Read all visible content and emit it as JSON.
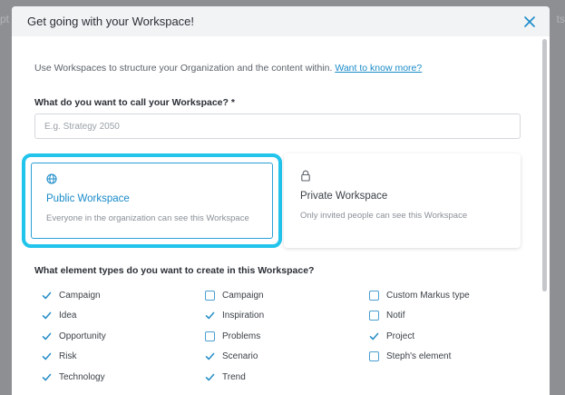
{
  "background": {
    "left_fragment": "pt",
    "right_fragment": "ts"
  },
  "modal": {
    "title": "Get going with your Workspace!",
    "intro_text": "Use Workspaces to structure your Organization and the content within.",
    "intro_link": "Want to know more?",
    "name_label": "What do you want to call your Workspace? *",
    "name_placeholder": "E.g. Strategy 2050",
    "public_card": {
      "title": "Public Workspace",
      "description": "Everyone in the organization can see this Workspace",
      "icon": "globe-icon"
    },
    "private_card": {
      "title": "Private Workspace",
      "description": "Only invited people can see this Workspace",
      "icon": "lock-icon"
    },
    "types_label": "What element types do you want to create in this Workspace?",
    "types": [
      [
        {
          "label": "Campaign",
          "checked": true
        },
        {
          "label": "Idea",
          "checked": true
        },
        {
          "label": "Opportunity",
          "checked": true
        },
        {
          "label": "Risk",
          "checked": true
        },
        {
          "label": "Technology",
          "checked": true
        }
      ],
      [
        {
          "label": "Campaign",
          "checked": false
        },
        {
          "label": "Inspiration",
          "checked": true
        },
        {
          "label": "Problems",
          "checked": false
        },
        {
          "label": "Scenario",
          "checked": true
        },
        {
          "label": "Trend",
          "checked": true
        }
      ],
      [
        {
          "label": "Custom Markus type",
          "checked": false
        },
        {
          "label": "Notif",
          "checked": false
        },
        {
          "label": "Project",
          "checked": true
        },
        {
          "label": "Steph's element",
          "checked": false
        }
      ]
    ]
  },
  "colors": {
    "accent": "#1a8bc9",
    "highlight": "#22c4ec",
    "check": "#2a8fc9"
  }
}
